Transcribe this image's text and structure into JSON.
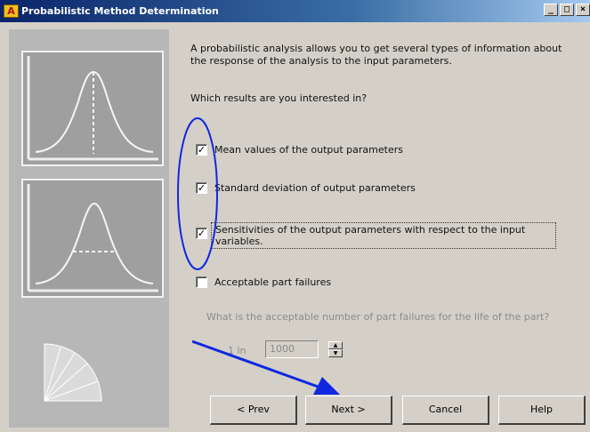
{
  "window": {
    "title": "Probabilistic Method Determination",
    "minimize": "_",
    "maximize": "□",
    "close": "×"
  },
  "intro_text": "A probabilistic analysis allows you to get several types of information about the response of the analysis to the input parameters.",
  "question_text": "Which results are you interested in?",
  "options": [
    {
      "label": "Mean values of the output parameters",
      "checked": true
    },
    {
      "label": "Standard deviation of output parameters",
      "checked": true
    },
    {
      "label": "Sensitivities of the output parameters with respect to the input variables.",
      "checked": true
    },
    {
      "label": "Acceptable part failures",
      "checked": false
    }
  ],
  "failures_prompt": "What is the acceptable number of part failures for the life of the part?",
  "failures_field_label": "1 in",
  "failures_field_value": "1000",
  "buttons": {
    "prev": "< Prev",
    "next": "Next >",
    "cancel": "Cancel",
    "help": "Help"
  },
  "colors": {
    "annotation_blue": "#1028e0",
    "title_bar": "#0a246a"
  },
  "icons": {
    "app": "app-logo-icon",
    "spin_up": "spin-up-icon",
    "spin_down": "spin-down-icon"
  }
}
